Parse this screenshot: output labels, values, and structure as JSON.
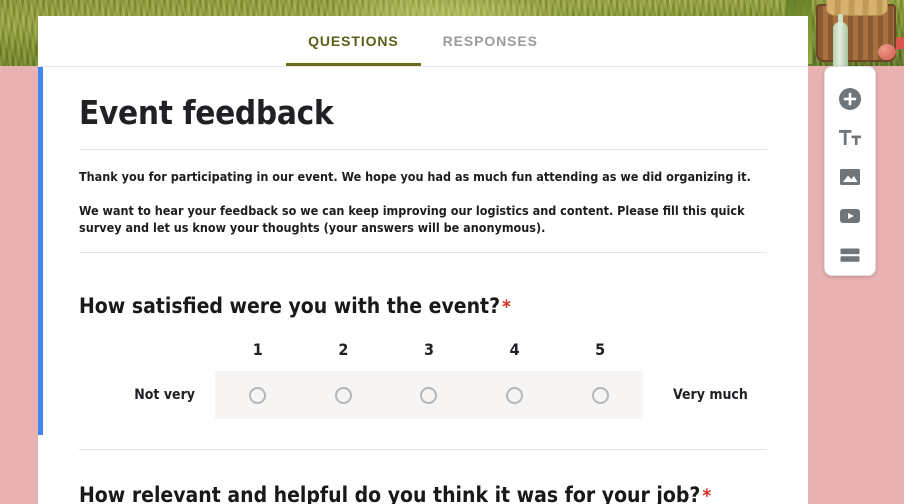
{
  "banner": {
    "alt": "picnic-basket-in-grass-header-image"
  },
  "tabs": [
    {
      "label": "QUESTIONS",
      "active": true
    },
    {
      "label": "RESPONSES",
      "active": false
    }
  ],
  "form": {
    "title": "Event feedback",
    "description_line_1": "Thank you for participating in our event. We hope you had as much fun attending as we did organizing it.",
    "description_line_2": "We want to hear your feedback so we can keep improving our logistics and content. Please fill this quick survey and let us know your thoughts (your answers will be anonymous).",
    "required_marker": "*",
    "accent_color": "#4285f4",
    "required_color": "#d93025",
    "active_tab_color": "#6b6d16",
    "page_background": "#e9b2b2"
  },
  "questions": [
    {
      "title": "How satisfied were you with the event?",
      "required": true,
      "type": "linear-scale",
      "low_label": "Not very",
      "high_label": "Very much",
      "options": [
        "1",
        "2",
        "3",
        "4",
        "5"
      ],
      "selected": null
    },
    {
      "title": "How relevant and helpful do you think it was for your job?",
      "required": true
    }
  ],
  "toolbar": [
    {
      "name": "add-question-button",
      "icon": "plus-circle-icon",
      "tooltip": "Add question"
    },
    {
      "name": "add-title-description-button",
      "icon": "title-text-icon",
      "tooltip": "Add title and description"
    },
    {
      "name": "add-image-button",
      "icon": "image-icon",
      "tooltip": "Add image"
    },
    {
      "name": "add-video-button",
      "icon": "video-icon",
      "tooltip": "Add video"
    },
    {
      "name": "add-section-button",
      "icon": "section-icon",
      "tooltip": "Add section"
    }
  ]
}
